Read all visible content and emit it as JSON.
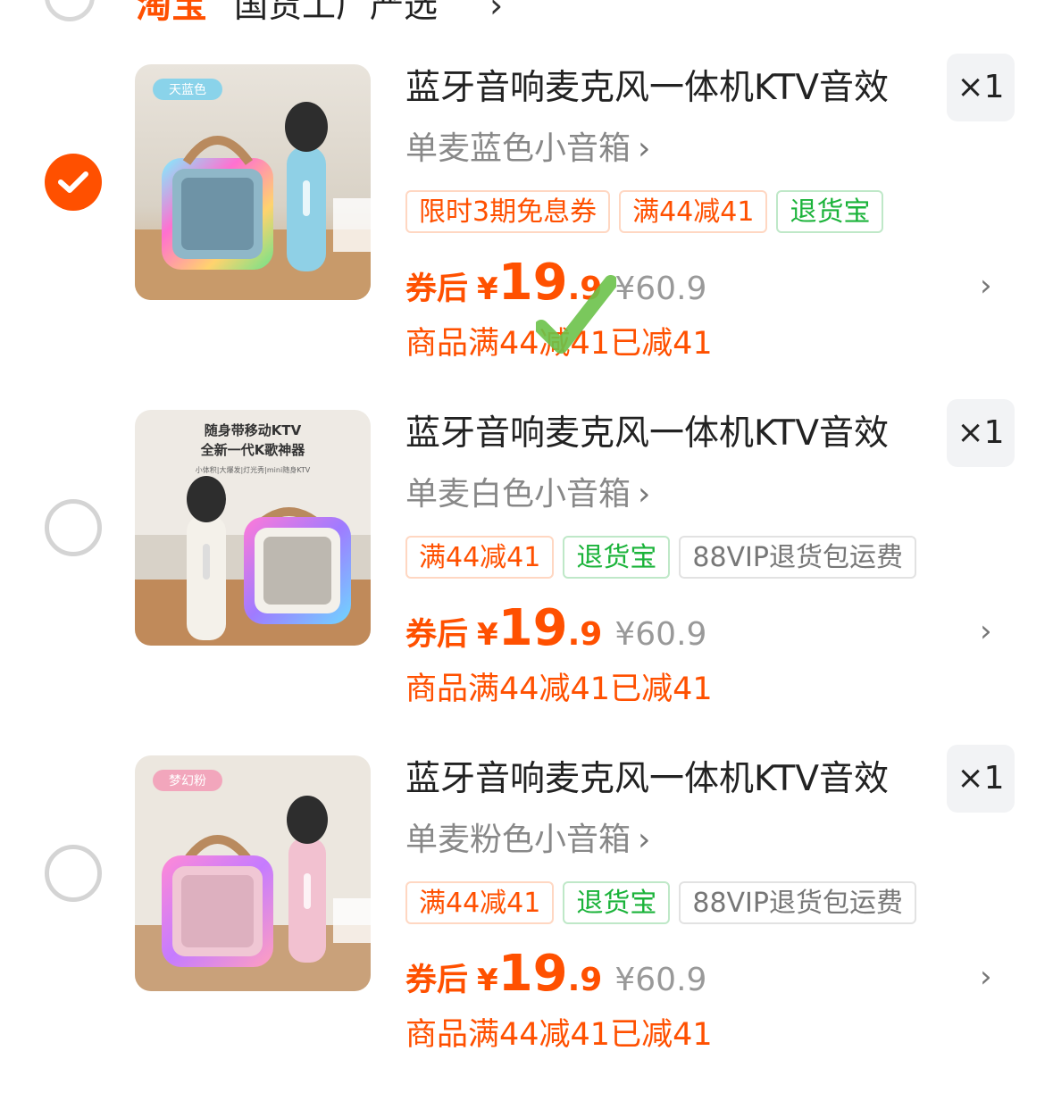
{
  "header": {
    "brand": "淘宝",
    "shop": "国货工厂严选",
    "chevron": "›"
  },
  "items": [
    {
      "selected": true,
      "image_badge": "天蓝色",
      "title": "蓝牙音响麦克风一体机KTV音效",
      "quantity": "×1",
      "sku": "单麦蓝色小音箱",
      "sku_arrow": "›",
      "tags": [
        {
          "text": "限时3期免息券",
          "style": "orange"
        },
        {
          "text": "满44减41",
          "style": "orange"
        },
        {
          "text": "退货宝",
          "style": "green"
        }
      ],
      "price_label": "券后",
      "currency": "¥",
      "price_int": "19",
      "price_dec": ".9",
      "original_price": "¥60.9",
      "saved_text": "商品满44减41已减41",
      "color_theme": "#7ec8e3"
    },
    {
      "selected": false,
      "image_headline_1": "随身带移动KTV",
      "image_headline_2": "全新一代K歌神器",
      "image_subline": "小体积|大爆发|灯光秀|mini随身KTV",
      "title": "蓝牙音响麦克风一体机KTV音效",
      "quantity": "×1",
      "sku": "单麦白色小音箱",
      "sku_arrow": "›",
      "tags": [
        {
          "text": "满44减41",
          "style": "orange"
        },
        {
          "text": "退货宝",
          "style": "green"
        },
        {
          "text": "88VIP退货包运费",
          "style": "gray"
        }
      ],
      "price_label": "券后",
      "currency": "¥",
      "price_int": "19",
      "price_dec": ".9",
      "original_price": "¥60.9",
      "saved_text": "商品满44减41已减41",
      "color_theme": "#f3eee6"
    },
    {
      "selected": false,
      "image_badge": "梦幻粉",
      "title": "蓝牙音响麦克风一体机KTV音效",
      "quantity": "×1",
      "sku": "单麦粉色小音箱",
      "sku_arrow": "›",
      "tags": [
        {
          "text": "满44减41",
          "style": "orange"
        },
        {
          "text": "退货宝",
          "style": "green"
        },
        {
          "text": "88VIP退货包运费",
          "style": "gray"
        }
      ],
      "price_label": "券后",
      "currency": "¥",
      "price_int": "19",
      "price_dec": ".9",
      "original_price": "¥60.9",
      "saved_text": "商品满44减41已减41",
      "color_theme": "#f2bfd0"
    }
  ],
  "icons": {
    "more": "›",
    "checkmark": "checkmark-icon",
    "watermark": "green-checkmark-watermark"
  },
  "colors": {
    "accent": "#ff5000",
    "green_tag": "#1bb33a",
    "muted": "#999999"
  }
}
